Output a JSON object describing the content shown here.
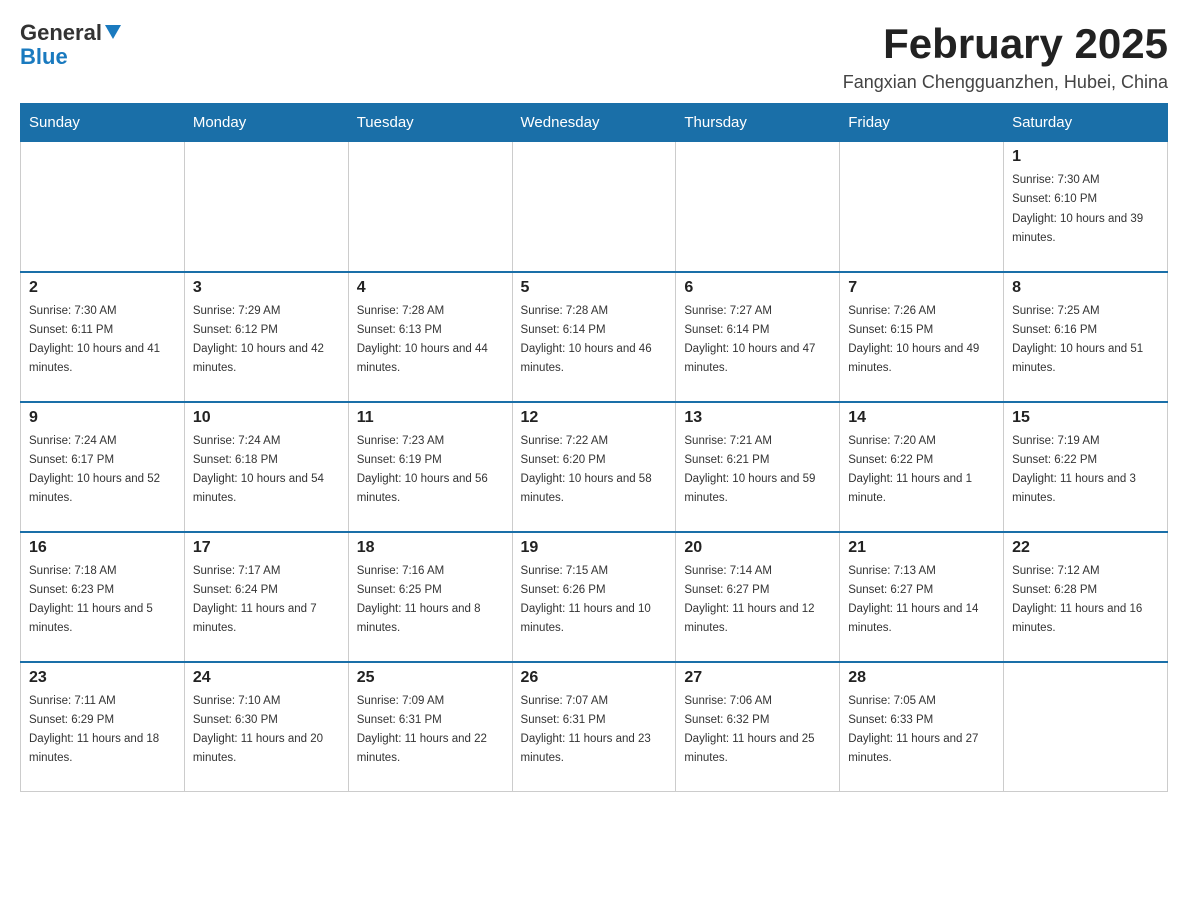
{
  "header": {
    "logo": {
      "general": "General",
      "blue": "Blue"
    },
    "title": "February 2025",
    "location": "Fangxian Chengguanzhen, Hubei, China"
  },
  "weekdays": [
    "Sunday",
    "Monday",
    "Tuesday",
    "Wednesday",
    "Thursday",
    "Friday",
    "Saturday"
  ],
  "weeks": [
    [
      {
        "day": "",
        "sunrise": "",
        "sunset": "",
        "daylight": ""
      },
      {
        "day": "",
        "sunrise": "",
        "sunset": "",
        "daylight": ""
      },
      {
        "day": "",
        "sunrise": "",
        "sunset": "",
        "daylight": ""
      },
      {
        "day": "",
        "sunrise": "",
        "sunset": "",
        "daylight": ""
      },
      {
        "day": "",
        "sunrise": "",
        "sunset": "",
        "daylight": ""
      },
      {
        "day": "",
        "sunrise": "",
        "sunset": "",
        "daylight": ""
      },
      {
        "day": "1",
        "sunrise": "Sunrise: 7:30 AM",
        "sunset": "Sunset: 6:10 PM",
        "daylight": "Daylight: 10 hours and 39 minutes."
      }
    ],
    [
      {
        "day": "2",
        "sunrise": "Sunrise: 7:30 AM",
        "sunset": "Sunset: 6:11 PM",
        "daylight": "Daylight: 10 hours and 41 minutes."
      },
      {
        "day": "3",
        "sunrise": "Sunrise: 7:29 AM",
        "sunset": "Sunset: 6:12 PM",
        "daylight": "Daylight: 10 hours and 42 minutes."
      },
      {
        "day": "4",
        "sunrise": "Sunrise: 7:28 AM",
        "sunset": "Sunset: 6:13 PM",
        "daylight": "Daylight: 10 hours and 44 minutes."
      },
      {
        "day": "5",
        "sunrise": "Sunrise: 7:28 AM",
        "sunset": "Sunset: 6:14 PM",
        "daylight": "Daylight: 10 hours and 46 minutes."
      },
      {
        "day": "6",
        "sunrise": "Sunrise: 7:27 AM",
        "sunset": "Sunset: 6:14 PM",
        "daylight": "Daylight: 10 hours and 47 minutes."
      },
      {
        "day": "7",
        "sunrise": "Sunrise: 7:26 AM",
        "sunset": "Sunset: 6:15 PM",
        "daylight": "Daylight: 10 hours and 49 minutes."
      },
      {
        "day": "8",
        "sunrise": "Sunrise: 7:25 AM",
        "sunset": "Sunset: 6:16 PM",
        "daylight": "Daylight: 10 hours and 51 minutes."
      }
    ],
    [
      {
        "day": "9",
        "sunrise": "Sunrise: 7:24 AM",
        "sunset": "Sunset: 6:17 PM",
        "daylight": "Daylight: 10 hours and 52 minutes."
      },
      {
        "day": "10",
        "sunrise": "Sunrise: 7:24 AM",
        "sunset": "Sunset: 6:18 PM",
        "daylight": "Daylight: 10 hours and 54 minutes."
      },
      {
        "day": "11",
        "sunrise": "Sunrise: 7:23 AM",
        "sunset": "Sunset: 6:19 PM",
        "daylight": "Daylight: 10 hours and 56 minutes."
      },
      {
        "day": "12",
        "sunrise": "Sunrise: 7:22 AM",
        "sunset": "Sunset: 6:20 PM",
        "daylight": "Daylight: 10 hours and 58 minutes."
      },
      {
        "day": "13",
        "sunrise": "Sunrise: 7:21 AM",
        "sunset": "Sunset: 6:21 PM",
        "daylight": "Daylight: 10 hours and 59 minutes."
      },
      {
        "day": "14",
        "sunrise": "Sunrise: 7:20 AM",
        "sunset": "Sunset: 6:22 PM",
        "daylight": "Daylight: 11 hours and 1 minute."
      },
      {
        "day": "15",
        "sunrise": "Sunrise: 7:19 AM",
        "sunset": "Sunset: 6:22 PM",
        "daylight": "Daylight: 11 hours and 3 minutes."
      }
    ],
    [
      {
        "day": "16",
        "sunrise": "Sunrise: 7:18 AM",
        "sunset": "Sunset: 6:23 PM",
        "daylight": "Daylight: 11 hours and 5 minutes."
      },
      {
        "day": "17",
        "sunrise": "Sunrise: 7:17 AM",
        "sunset": "Sunset: 6:24 PM",
        "daylight": "Daylight: 11 hours and 7 minutes."
      },
      {
        "day": "18",
        "sunrise": "Sunrise: 7:16 AM",
        "sunset": "Sunset: 6:25 PM",
        "daylight": "Daylight: 11 hours and 8 minutes."
      },
      {
        "day": "19",
        "sunrise": "Sunrise: 7:15 AM",
        "sunset": "Sunset: 6:26 PM",
        "daylight": "Daylight: 11 hours and 10 minutes."
      },
      {
        "day": "20",
        "sunrise": "Sunrise: 7:14 AM",
        "sunset": "Sunset: 6:27 PM",
        "daylight": "Daylight: 11 hours and 12 minutes."
      },
      {
        "day": "21",
        "sunrise": "Sunrise: 7:13 AM",
        "sunset": "Sunset: 6:27 PM",
        "daylight": "Daylight: 11 hours and 14 minutes."
      },
      {
        "day": "22",
        "sunrise": "Sunrise: 7:12 AM",
        "sunset": "Sunset: 6:28 PM",
        "daylight": "Daylight: 11 hours and 16 minutes."
      }
    ],
    [
      {
        "day": "23",
        "sunrise": "Sunrise: 7:11 AM",
        "sunset": "Sunset: 6:29 PM",
        "daylight": "Daylight: 11 hours and 18 minutes."
      },
      {
        "day": "24",
        "sunrise": "Sunrise: 7:10 AM",
        "sunset": "Sunset: 6:30 PM",
        "daylight": "Daylight: 11 hours and 20 minutes."
      },
      {
        "day": "25",
        "sunrise": "Sunrise: 7:09 AM",
        "sunset": "Sunset: 6:31 PM",
        "daylight": "Daylight: 11 hours and 22 minutes."
      },
      {
        "day": "26",
        "sunrise": "Sunrise: 7:07 AM",
        "sunset": "Sunset: 6:31 PM",
        "daylight": "Daylight: 11 hours and 23 minutes."
      },
      {
        "day": "27",
        "sunrise": "Sunrise: 7:06 AM",
        "sunset": "Sunset: 6:32 PM",
        "daylight": "Daylight: 11 hours and 25 minutes."
      },
      {
        "day": "28",
        "sunrise": "Sunrise: 7:05 AM",
        "sunset": "Sunset: 6:33 PM",
        "daylight": "Daylight: 11 hours and 27 minutes."
      },
      {
        "day": "",
        "sunrise": "",
        "sunset": "",
        "daylight": ""
      }
    ]
  ]
}
